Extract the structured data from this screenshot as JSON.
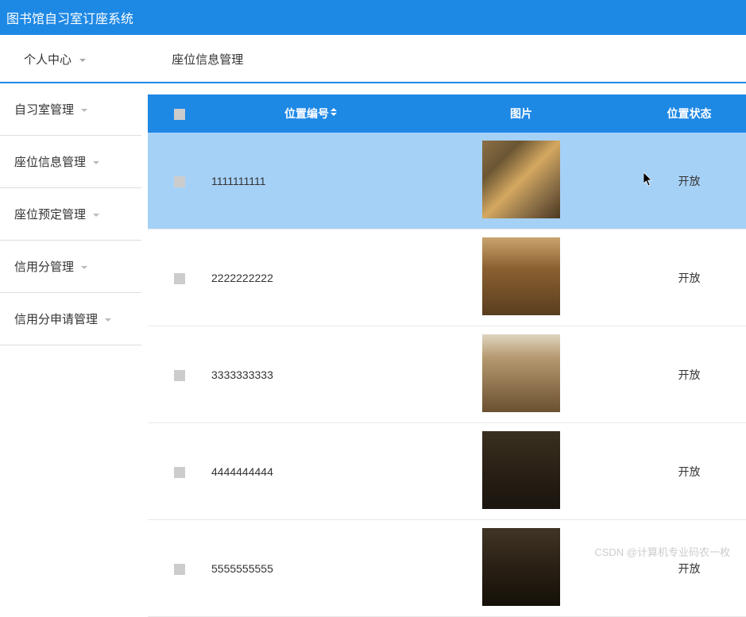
{
  "app_title": "图书馆自习室订座系统",
  "top_nav": {
    "items": [
      {
        "label": "个人中心",
        "has_caret": true
      },
      {
        "label": "座位信息管理",
        "has_caret": false
      }
    ]
  },
  "sidebar": {
    "items": [
      {
        "label": "自习室管理"
      },
      {
        "label": "座位信息管理"
      },
      {
        "label": "座位预定管理"
      },
      {
        "label": "信用分管理"
      },
      {
        "label": "信用分申请管理"
      }
    ]
  },
  "table": {
    "headers": {
      "col_id": "位置编号",
      "col_img": "图片",
      "col_status": "位置状态"
    },
    "rows": [
      {
        "id": "1111111111",
        "status": "开放",
        "img_variant": "v1",
        "selected": true
      },
      {
        "id": "2222222222",
        "status": "开放",
        "img_variant": "v2",
        "selected": false
      },
      {
        "id": "3333333333",
        "status": "开放",
        "img_variant": "v3",
        "selected": false
      },
      {
        "id": "4444444444",
        "status": "开放",
        "img_variant": "v4",
        "selected": false
      },
      {
        "id": "5555555555",
        "status": "开放",
        "img_variant": "v5",
        "selected": false
      }
    ]
  },
  "watermark": "CSDN @计算机专业码农一枚"
}
